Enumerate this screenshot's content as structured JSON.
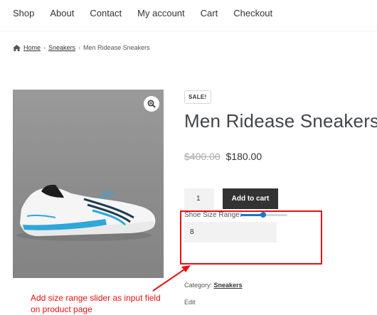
{
  "nav": {
    "items": [
      "Shop",
      "About",
      "Contact",
      "My account",
      "Cart",
      "Checkout"
    ]
  },
  "breadcrumb": {
    "home": "Home",
    "category": "Sneakers",
    "current": "Men Ridease Sneakers",
    "separator": "›"
  },
  "product": {
    "sale_badge": "SALE!",
    "title": "Men Ridease Sneakers",
    "old_price": "$400.00",
    "new_price": "$180.00",
    "quantity": "1",
    "add_to_cart": "Add to cart",
    "size_label": "Shoe Size Range:",
    "size_slider_fraction": 0.48,
    "size_value": "8",
    "category_label": "Category:",
    "category": "Sneakers",
    "edit": "Edit"
  },
  "annotation": {
    "line1": "Add size range slider as input field",
    "line2": "on product page"
  },
  "colors": {
    "annotation_red": "#e81010",
    "slider_blue": "#1b75d0",
    "button_dark": "#333333"
  }
}
